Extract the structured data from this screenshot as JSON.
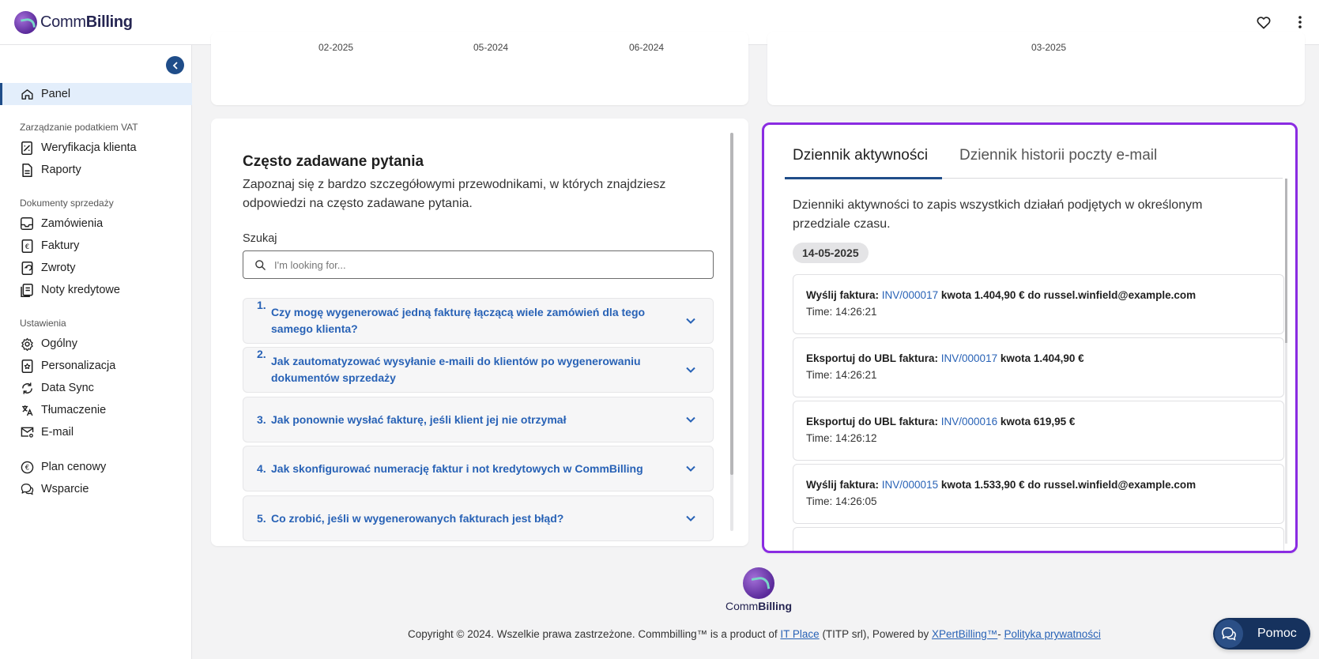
{
  "app": {
    "brand_light": "Comm",
    "brand_bold": "Billing"
  },
  "sidebar": {
    "items": {
      "panel": "Panel",
      "weryfikacja": "Weryfikacja klienta",
      "raporty": "Raporty",
      "zamowienia": "Zamówienia",
      "faktury": "Faktury",
      "zwroty": "Zwroty",
      "noty": "Noty kredytowe",
      "ogolny": "Ogólny",
      "personalizacja": "Personalizacja",
      "datasync": "Data Sync",
      "tlumaczenie": "Tłumaczenie",
      "email": "E-mail",
      "plan": "Plan cenowy",
      "wsparcie": "Wsparcie"
    },
    "sections": {
      "vat": "Zarządzanie podatkiem VAT",
      "sales": "Dokumenty sprzedaży",
      "settings": "Ustawienia"
    }
  },
  "charts": {
    "left_ticks": [
      "02-2025",
      "05-2024",
      "06-2024"
    ],
    "right_ticks": [
      "03-2025"
    ]
  },
  "faq": {
    "title": "Często zadawane pytania",
    "description": "Zapoznaj się z bardzo szczegółowymi przewodnikami, w których znajdziesz odpowiedzi na często zadawane pytania.",
    "search_label": "Szukaj",
    "search_placeholder": "I'm looking for...",
    "items": [
      {
        "num": "1.",
        "q": "Czy mogę wygenerować jedną fakturę łączącą wiele zamówień dla tego samego klienta?"
      },
      {
        "num": "2.",
        "q": "Jak zautomatyzować wysyłanie e-maili do klientów po wygenerowaniu dokumentów sprzedaży"
      },
      {
        "num": "3.",
        "q": "Jak ponownie wysłać fakturę, jeśli klient jej nie otrzymał"
      },
      {
        "num": "4.",
        "q": "Jak skonfigurować numerację faktur i not kredytowych w CommBilling"
      },
      {
        "num": "5.",
        "q": "Co zrobić, jeśli w wygenerowanych fakturach jest błąd?"
      }
    ]
  },
  "activity": {
    "tab_active": "Dziennik aktywności",
    "tab_other": "Dziennik historii poczty e-mail",
    "description": "Dzienniki aktywności to zapis wszystkich działań podjętych w określonym przedziale czasu.",
    "date": "14-05-2025",
    "entries": [
      {
        "prefix": "Wyślij faktura: ",
        "inv": "INV/000017",
        "suffix": " kwota 1.404,90 € do russel.winfield@example.com",
        "time": "Time: 14:26:21"
      },
      {
        "prefix": "Eksportuj do UBL faktura: ",
        "inv": "INV/000017",
        "suffix": " kwota 1.404,90 €",
        "time": "Time: 14:26:21"
      },
      {
        "prefix": "Eksportuj do UBL faktura: ",
        "inv": "INV/000016",
        "suffix": " kwota 619,95 €",
        "time": "Time: 14:26:12"
      },
      {
        "prefix": "Wyślij faktura: ",
        "inv": "INV/000015",
        "suffix": " kwota 1.533,90 € do russel.winfield@example.com",
        "time": "Time: 14:26:05"
      }
    ]
  },
  "footer": {
    "brand_light": "Comm",
    "brand_bold": "Billing",
    "copyright_1": "Copyright © 2024. Wszelkie prawa zastrzeżone. Commbilling™ is a product of ",
    "link_itplace": "IT Place",
    "copyright_2": " (TITP srl), Powered by ",
    "link_xpert": "XPertBilling™",
    "copyright_3": "- ",
    "link_privacy": "Polityka prywatności"
  },
  "help": {
    "label": "Pomoc"
  },
  "colors": {
    "accent": "#1f4d89",
    "link": "#2862b6",
    "highlight_border": "#8a2be2"
  }
}
